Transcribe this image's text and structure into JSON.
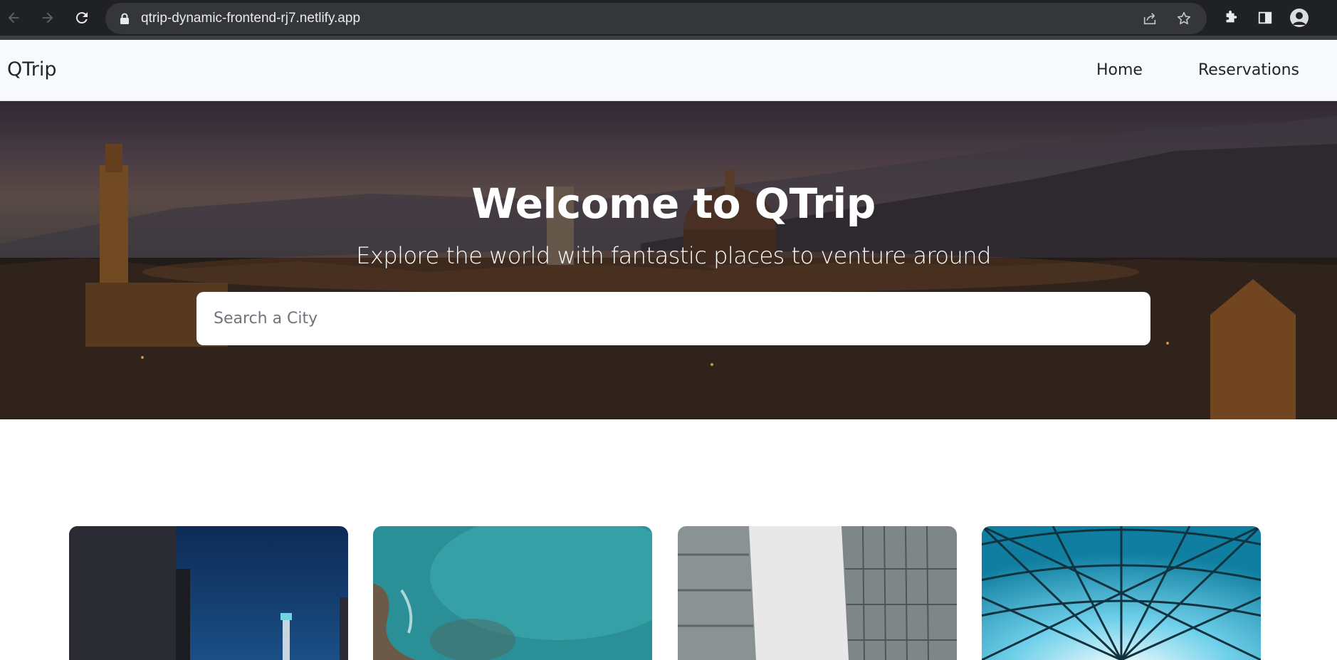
{
  "browser": {
    "url": "qtrip-dynamic-frontend-rj7.netlify.app",
    "icons": [
      "back-arrow-icon",
      "forward-arrow-icon",
      "reload-icon",
      "lock-icon",
      "share-icon",
      "star-icon",
      "extensions-icon",
      "side-panel-icon",
      "profile-avatar"
    ]
  },
  "navbar": {
    "brand": "QTrip",
    "links": [
      {
        "label": "Home"
      },
      {
        "label": "Reservations"
      }
    ]
  },
  "hero": {
    "title": "Welcome to QTrip",
    "subtitle": "Explore the world with fantastic places to venture around",
    "search_placeholder": "Search a City"
  },
  "cities": [
    {
      "image": "night-city-tower"
    },
    {
      "image": "turquoise-sea-rocks"
    },
    {
      "image": "glass-skyscrapers"
    },
    {
      "image": "glass-dome-lattice"
    }
  ],
  "colors": {
    "chrome_bg": "#202124",
    "omnibox_bg": "#35363a",
    "navbar_bg": "#f8f9fa",
    "text_dark": "#212529"
  }
}
